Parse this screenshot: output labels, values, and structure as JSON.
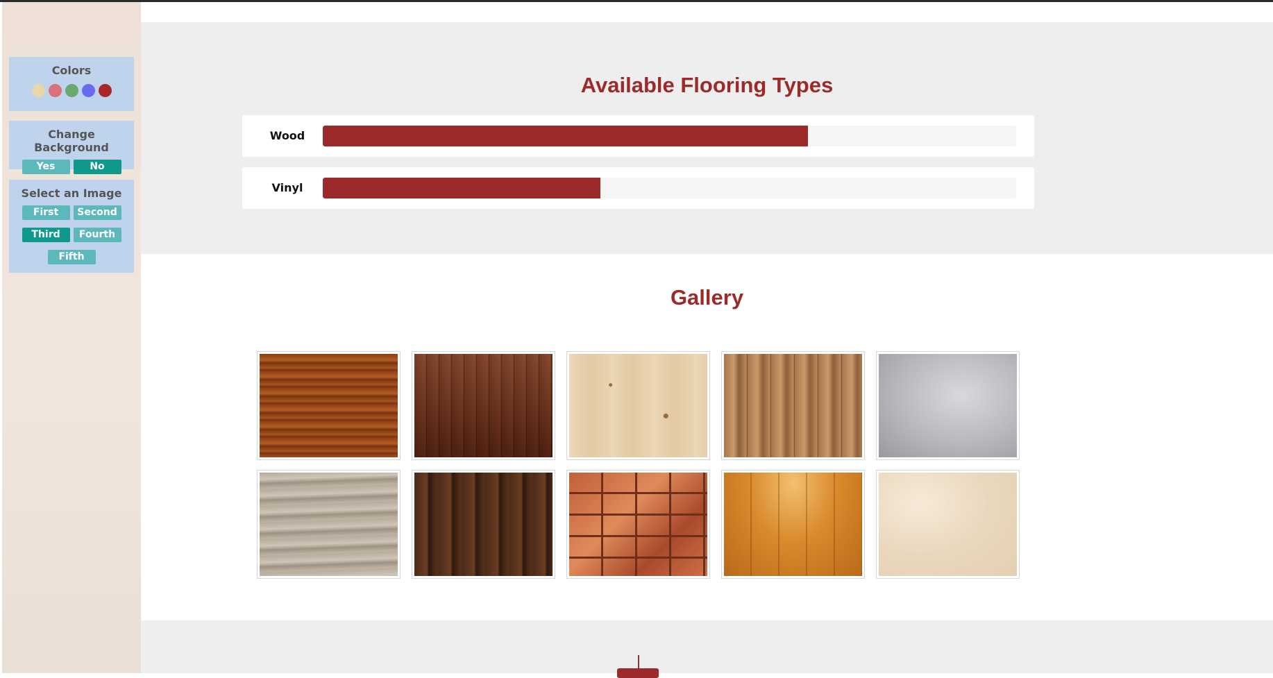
{
  "settings": {
    "colors_title": "Colors",
    "swatches": [
      "#e8d8a8",
      "#d9707c",
      "#6aaa72",
      "#6a6af0",
      "#a62828"
    ],
    "background_title": "Change Background",
    "background_yes": "Yes",
    "background_no": "No",
    "image_title": "Select an Image",
    "image_first": "First",
    "image_second": "Second",
    "image_third": "Third",
    "image_fourth": "Fourth",
    "image_fifth": "Fifth"
  },
  "skills": {
    "title": "Available Flooring Types",
    "items": [
      {
        "label": "Wood",
        "percent": 70
      },
      {
        "label": "Vinyl",
        "percent": 40
      }
    ]
  },
  "gallery": {
    "title": "Gallery"
  },
  "colors": {
    "accent": "#9c2a2a",
    "button": "#5cb8bb",
    "button_active": "#0e998c"
  }
}
